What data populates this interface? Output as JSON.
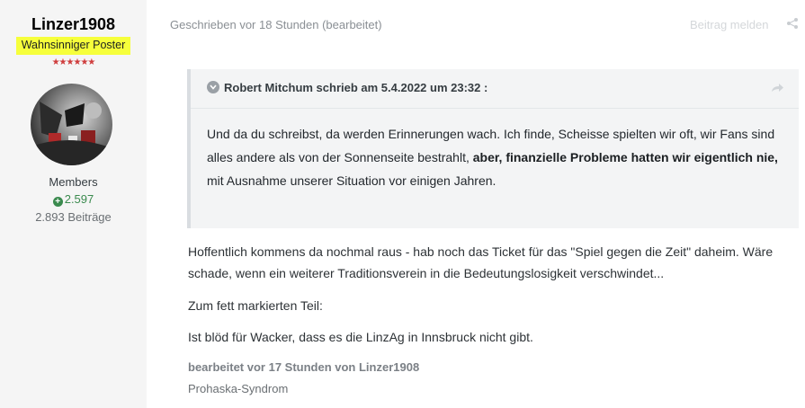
{
  "author": {
    "username": "Linzer1908",
    "title": "Wahnsinniger Poster",
    "stars": "★★★★★★",
    "group": "Members",
    "reputation": "2.597",
    "post_count": "2.893 Beiträge",
    "title_highlight_color": "#f6ff3b",
    "avatar_icon": "avatar-image"
  },
  "post": {
    "meta": "Geschrieben vor 18 Stunden (bearbeitet)",
    "report_label": "Beitrag melden",
    "quote": {
      "header": "Robert Mitchum schrieb am 5.4.2022 um 23:32 :",
      "text_before": "Und da du schreibst, da werden Erinnerungen wach. Ich finde, Scheisse spielten wir oft, wir Fans sind alles andere als von der Sonnenseite bestrahlt, ",
      "text_bold": "aber, finanzielle Probleme hatten wir eigentlich nie,",
      "text_after": " mit Ausnahme unserer Situation vor einigen Jahren."
    },
    "paragraphs": [
      "Hoffentlich kommens da nochmal raus - hab noch das Ticket für das \"Spiel gegen die Zeit\" daheim. Wäre schade, wenn ein weiterer Traditionsverein in die Bedeutungslosigkeit verschwindet...",
      "Zum fett markierten Teil:",
      "Ist blöd für Wacker, dass es die LinzAg in Innsbruck nicht gibt."
    ],
    "edited": "bearbeitet vor 17 Stunden von Linzer1908",
    "signature": "Prohaska-Syndrom"
  }
}
